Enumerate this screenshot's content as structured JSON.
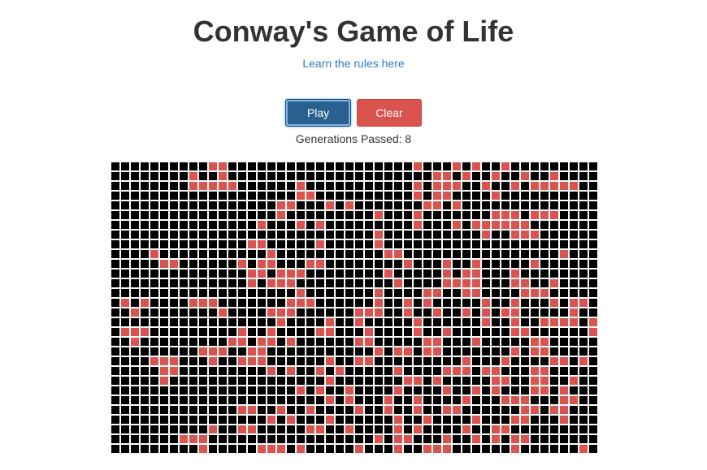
{
  "header": {
    "title": "Conway's Game of Life",
    "rules_link": "Learn the rules here"
  },
  "controls": {
    "play_label": "Play",
    "clear_label": "Clear"
  },
  "status": {
    "generations_label": "Generations Passed: 8"
  },
  "board": {
    "cols": 50,
    "rows": 30,
    "dead_color": "#000000",
    "alive_color": "#d9534f",
    "rows_data": [
      "..........##...................#...#.#..#.........",
      "........#..#.....................##.#..#..#..#....",
      "........#####......#...........#.###..#..#.#####..",
      "...................##..........#.##....#..........",
      ".................##...#.#.......##.#..............",
      ".................#.........#...#.......###.###....",
      "...............#...#.#.........#...#.######.......",
      "...........................#..........#..###......",
      "..............##.....#.....#......................",
      "....#...........#...........##................#...",
      ".....##......#.##...##........#...#..#.....#......",
      "..............##.###........#.....#.##...#........",
      "..............#.###..........#....####...##..#....",
      "...................#.......#....##..##....###.....",
      ".#.#....###.......###......#..#.#.....#..#...#.##.",
      "..#........#....###......###..#..#..#.#.##.....#..",
      ".................#....#..#.....#......#..#..####.#",
      ".###.........#..#....##...#....#..#......##......#",
      "..#.........##.##.#......##.....##...#.....##.....",
      ".........###..##...........#.##.##.......#.##.....",
      "....###...#..###......#..##.........#...#....##.#.",
      ".....##.........#.#..#.#.....#....###.##...##.....",
      ".....#................#.......##.#.....##..##..#..",
      "...................#.#..#....#....#..#.#...##.#...",
      "......................#.#...#..#....#...###...##..",
      ".............##..#..#....#..#..#..##......##.##...",
      "................#.#...#......#..#....#...##...#...",
      "..........#..##.....##..#....#.#....#..##.........",
      ".......###.................#.##...#..#.#.##.......",
      ".........#.....###.#.....#...#..###......#......#."
    ]
  }
}
